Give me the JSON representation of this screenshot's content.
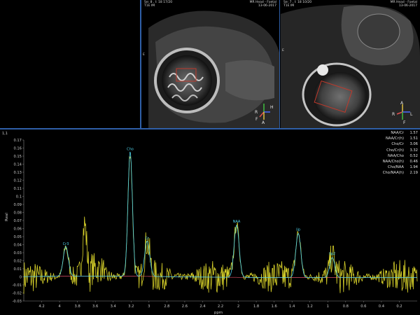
{
  "viewports": [
    {
      "id": "left",
      "header_left_1": "Se: 8 , I: 18 17/20",
      "header_left_2": "T1E  IM",
      "header_right_1": "MR Head - Foetal",
      "header_right_2": "13-06-2017",
      "side_marker": "E",
      "orientation": {
        "r": "R",
        "h": "H",
        "a": "A",
        "f": "F"
      }
    },
    {
      "id": "right",
      "header_left_1": "Se: 7 , I: 18 10/20",
      "header_left_2": "T1E  IM",
      "header_right_1": "MR Head - Foetal",
      "header_right_2": "13-06-2017",
      "side_marker": "E",
      "orientation": {
        "r": "R",
        "l": "L",
        "a": "A",
        "f": "F"
      }
    }
  ],
  "spectrum": {
    "index_label": "1,1",
    "ratios": [
      {
        "label": "NAA/Cr",
        "value": "1.57"
      },
      {
        "label": "NAA/Cr(h)",
        "value": "1.51"
      },
      {
        "label": "Cho/Cr",
        "value": "3.06"
      },
      {
        "label": "Cho/Cr(h)",
        "value": "3.32"
      },
      {
        "label": "NAA/Cho",
        "value": "0.52"
      },
      {
        "label": "NAA/Cho(h)",
        "value": "0.46"
      },
      {
        "label": "Cho/NAA",
        "value": "1.94"
      },
      {
        "label": "Cho/NAA(h)",
        "value": "2.19"
      }
    ]
  },
  "chart_data": {
    "type": "line",
    "xlabel": "ppm",
    "ylabel": "Real",
    "xlim": [
      4.4,
      0.0
    ],
    "ylim": [
      -0.03,
      0.17
    ],
    "x_reversed": true,
    "grid": false,
    "x_ticks": [
      "4.2",
      "4",
      "3.8",
      "3.6",
      "3.4",
      "3.2",
      "3",
      "2.8",
      "2.6",
      "2.4",
      "2.2",
      "2",
      "1.8",
      "1.6",
      "1.4",
      "1.2",
      "1",
      "0.8",
      "0.6",
      "0.4",
      "0.2"
    ],
    "y_ticks": [
      "0.17",
      "0.16",
      "0.15",
      "0.14",
      "0.13",
      "0.12",
      "0.11",
      "0.1",
      "0.09",
      "0.08",
      "0.07",
      "0.06",
      "0.05",
      "0.04",
      "0.03",
      "0.02",
      "0.01",
      "0",
      "-0.01",
      "-0.02",
      "-0.03"
    ],
    "peaks": [
      {
        "name": "Cr3",
        "ppm": 3.93,
        "height": 0.037
      },
      {
        "name": "Cho",
        "ppm": 3.21,
        "height": 0.155
      },
      {
        "name": "Cr",
        "ppm": 3.02,
        "height": 0.044
      },
      {
        "name": "NAA",
        "ppm": 2.02,
        "height": 0.065
      },
      {
        "name": "lip",
        "ppm": 1.33,
        "height": 0.055
      },
      {
        "name": "lip2",
        "ppm": 0.95,
        "height": 0.025
      }
    ],
    "series": [
      {
        "color": "#d8d22a"
      },
      {
        "color": "#4fd0e8"
      },
      {
        "color": "#e0506a"
      }
    ],
    "colors": {
      "measured": "#d8d22a",
      "fit": "#4fd0e8",
      "baseline": "#e0506a",
      "separator": "#2f5fa8"
    }
  }
}
